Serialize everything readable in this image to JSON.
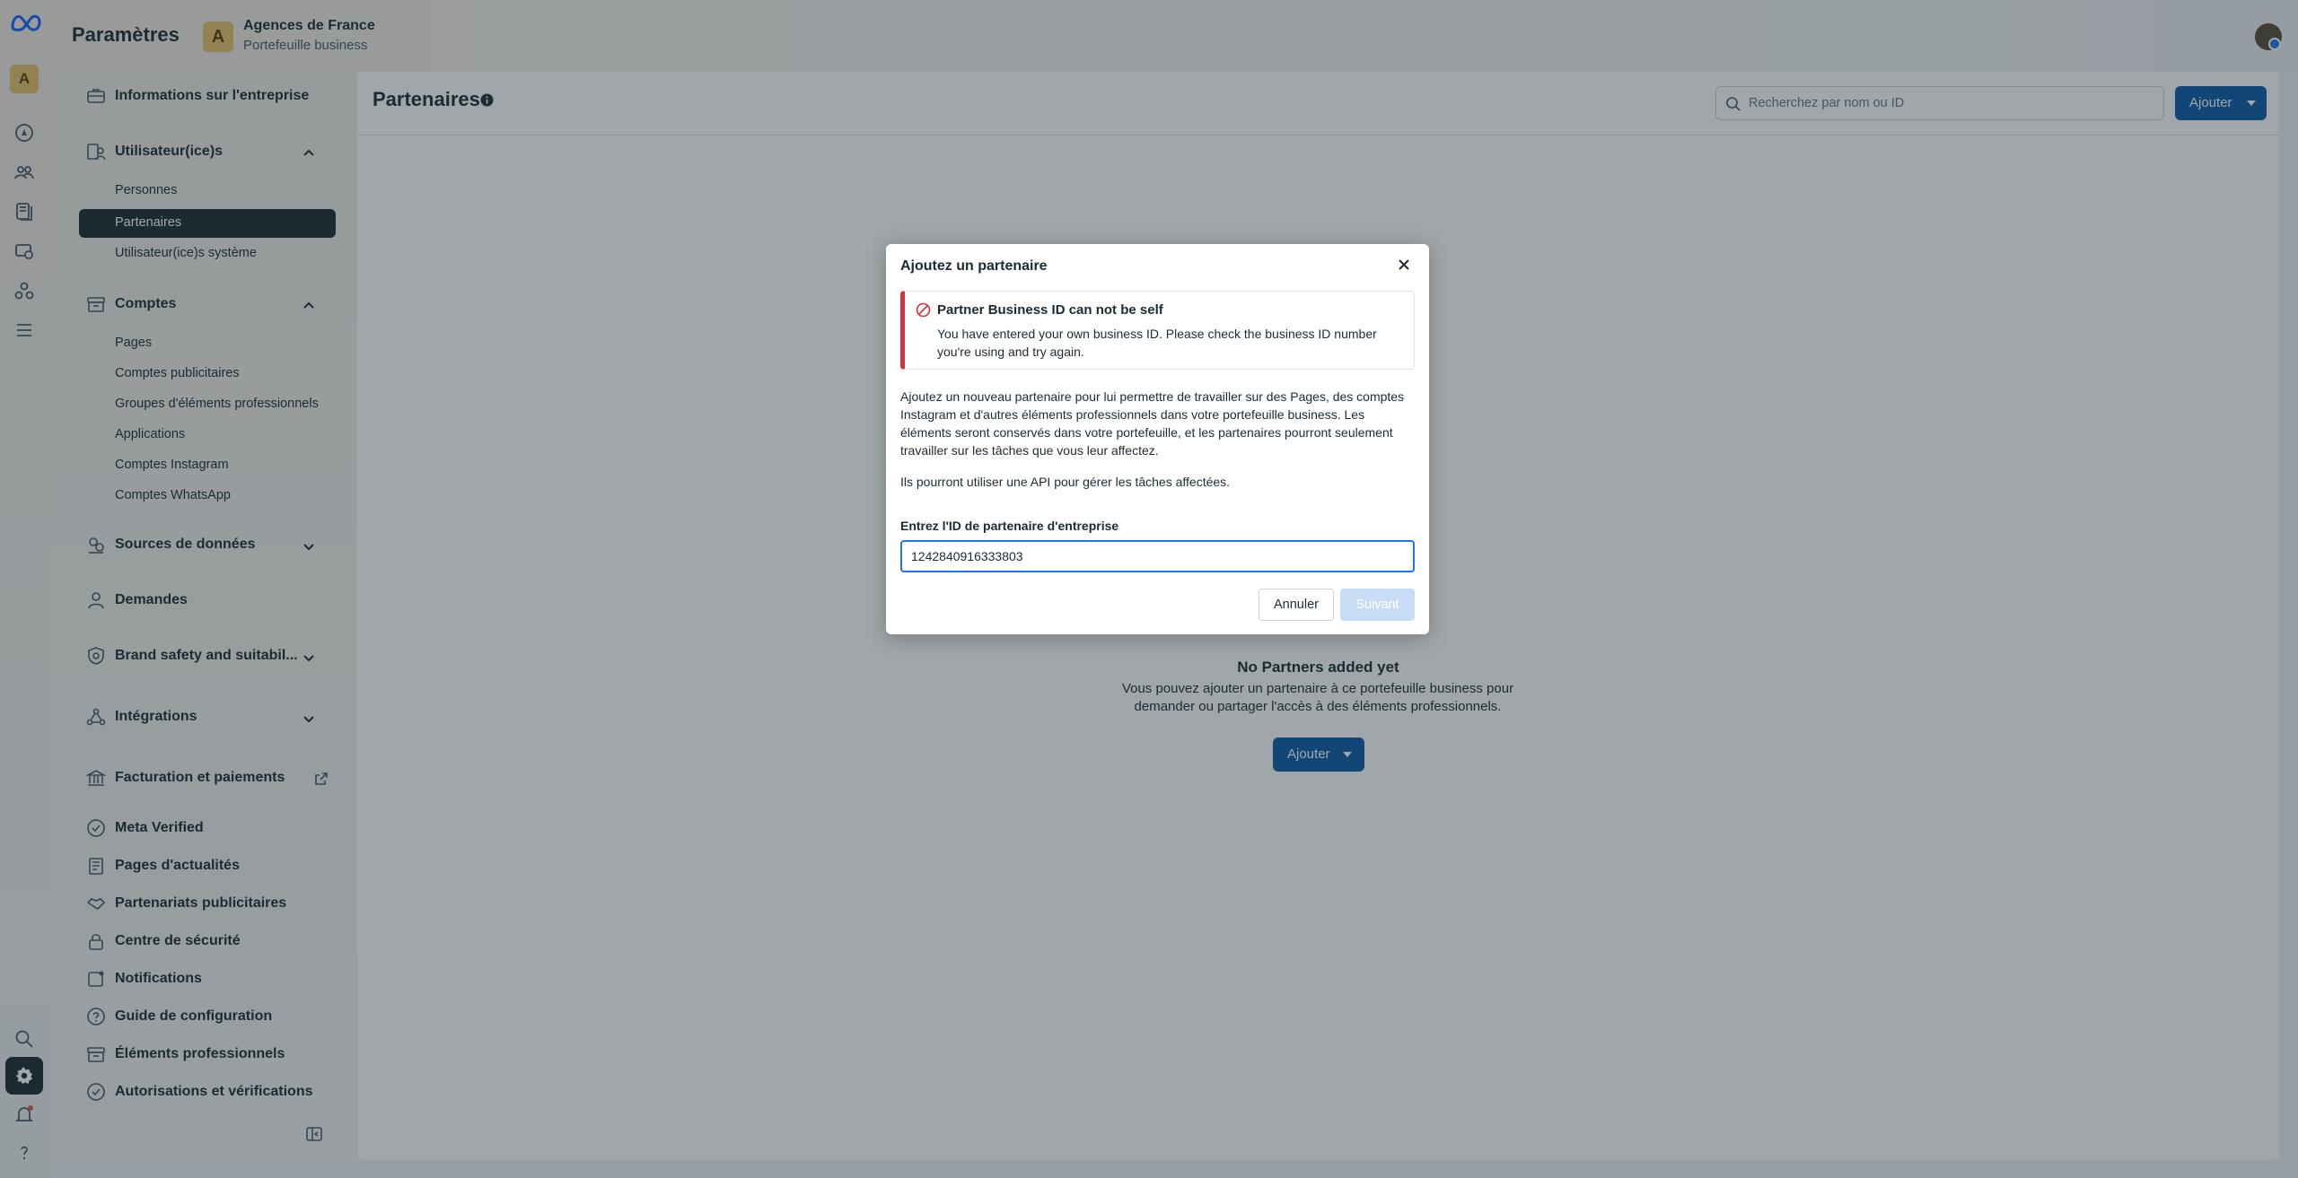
{
  "header": {
    "app_title": "Paramètres",
    "business_initial": "A",
    "business_name": "Agences de France",
    "business_subtitle": "Portefeuille business"
  },
  "rail": {
    "avatar_initial": "A",
    "icons": [
      "home-icon",
      "people-icon",
      "pages-icon",
      "ads-icon",
      "integrations-icon",
      "menu-icon",
      "search-icon",
      "settings-icon",
      "notifications-icon",
      "help-icon"
    ]
  },
  "sidebar": {
    "business_info": "Informations sur l'entreprise",
    "users": {
      "label": "Utilisateur(ice)s",
      "items": [
        "Personnes",
        "Partenaires",
        "Utilisateur(ice)s système"
      ],
      "active": "Partenaires"
    },
    "accounts": {
      "label": "Comptes",
      "items": [
        "Pages",
        "Comptes publicitaires",
        "Groupes d'éléments professionnels",
        "Applications",
        "Comptes Instagram",
        "Comptes WhatsApp"
      ]
    },
    "data_sources": "Sources de données",
    "requests": "Demandes",
    "brand_safety": "Brand safety and suitabil...",
    "integrations": "Intégrations",
    "billing": "Facturation et paiements",
    "meta_verified": "Meta Verified",
    "news_pages": "Pages d'actualités",
    "ad_partnerships": "Partenariats publicitaires",
    "security_center": "Centre de sécurité",
    "notifications": "Notifications",
    "setup_guide": "Guide de configuration",
    "business_assets": "Éléments professionnels",
    "permissions": "Autorisations et vérifications"
  },
  "main": {
    "title": "Partenaires",
    "search_placeholder": "Recherchez par nom ou ID",
    "add_label": "Ajouter",
    "empty_title": "No Partners added yet",
    "empty_desc": "Vous pouvez ajouter un partenaire à ce portefeuille business pour demander ou partager l'accès à des éléments professionnels.",
    "empty_add_label": "Ajouter"
  },
  "modal": {
    "title": "Ajoutez un partenaire",
    "alert_title": "Partner Business ID can not be self",
    "alert_body": "You have entered your own business ID. Please check the business ID number you're using and try again.",
    "description": "Ajoutez un nouveau partenaire pour lui permettre de travailler sur des Pages, des comptes Instagram et d'autres éléments professionnels dans votre portefeuille business. Les éléments seront conservés dans votre portefeuille, et les partenaires pourront seulement travailler sur les tâches que vous leur affectez.",
    "description2": "Ils pourront utiliser une API pour gérer les tâches affectées.",
    "field_label": "Entrez l'ID de partenaire d'entreprise",
    "field_value": "1242840916333803",
    "cancel_label": "Annuler",
    "next_label": "Suivant"
  },
  "colors": {
    "primary": "#0a5ba8",
    "error": "#d6303c",
    "focus": "#1877f2",
    "sidebar_active": "#1c2b33"
  }
}
